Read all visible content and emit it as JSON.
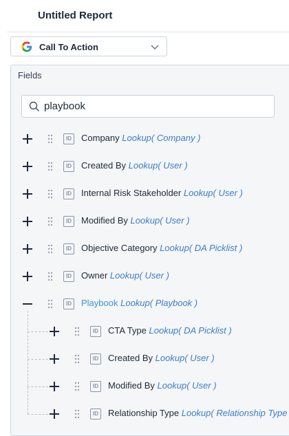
{
  "header": {
    "title": "Untitled Report"
  },
  "source": {
    "label": "Call To Action",
    "icon": "google-icon"
  },
  "fields": {
    "header": "Fields",
    "search_value": "playbook",
    "items": [
      {
        "name": "Company",
        "type": "Lookup( Company )"
      },
      {
        "name": "Created By",
        "type": "Lookup( User )"
      },
      {
        "name": "Internal Risk Stakeholder",
        "type": "Lookup( User )"
      },
      {
        "name": "Modified By",
        "type": "Lookup( User )"
      },
      {
        "name": "Objective Category",
        "type": "Lookup( DA Picklist )"
      },
      {
        "name": "Owner",
        "type": "Lookup( User )"
      },
      {
        "name": "Playbook",
        "type": "Lookup( Playbook )",
        "expanded": true
      }
    ],
    "children": [
      {
        "name": "CTA Type",
        "type": "Lookup( DA Picklist )"
      },
      {
        "name": "Created By",
        "type": "Lookup( User )"
      },
      {
        "name": "Modified By",
        "type": "Lookup( User )"
      },
      {
        "name": "Relationship Type",
        "type": "Lookup( Relationship Type )"
      }
    ]
  },
  "colors": {
    "accent": "#3d95d6",
    "type_text": "#3d7cc9",
    "panel_bg": "#f4f6f8"
  }
}
